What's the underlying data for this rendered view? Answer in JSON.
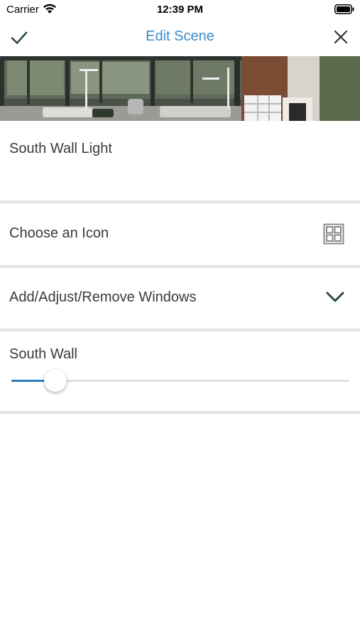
{
  "status_bar": {
    "carrier": "Carrier",
    "time": "12:39 PM"
  },
  "nav": {
    "title": "Edit Scene",
    "confirm_icon": "checkmark-icon",
    "close_icon": "close-icon"
  },
  "hero": {
    "icon": "room-photo"
  },
  "scene": {
    "name": "South Wall Light"
  },
  "icon_row": {
    "label": "Choose an Icon",
    "icon": "window-grid-icon"
  },
  "windows_row": {
    "label": "Add/Adjust/Remove Windows",
    "icon": "chevron-down-icon"
  },
  "sliders": [
    {
      "label": "South Wall",
      "value": 0.13
    }
  ],
  "colors": {
    "accent": "#3a8bc8",
    "slider_fill": "#2c7fc0",
    "icon_dark": "#2e4a45",
    "divider": "#e3e3e3"
  }
}
